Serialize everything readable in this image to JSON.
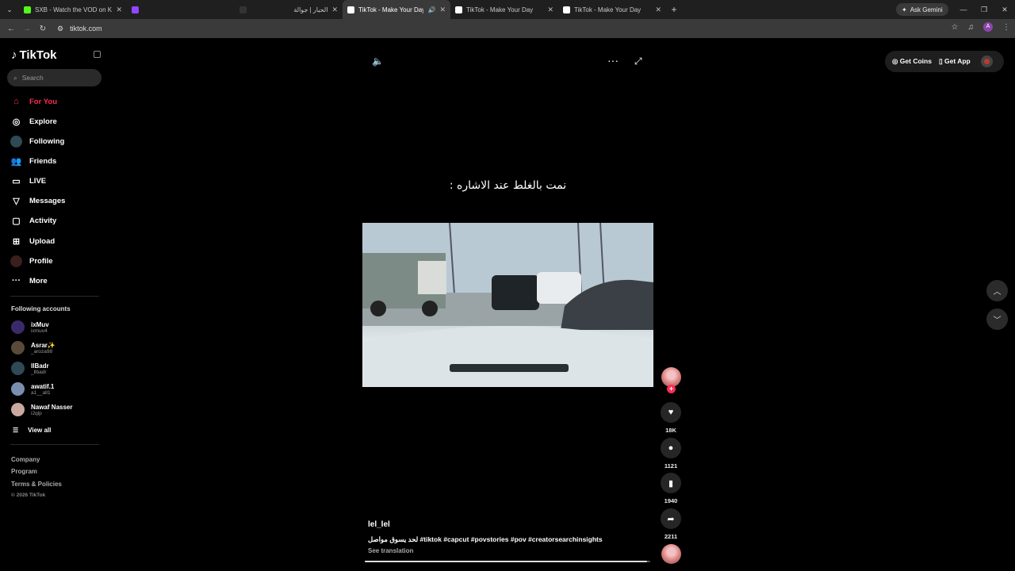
{
  "browser": {
    "tabs": [
      {
        "title": "SXB - Watch the VOD on Kick",
        "color": "#53fc18",
        "active": false,
        "audio": false
      },
      {
        "title": "",
        "color": "#9147ff",
        "active": false,
        "audio": false
      },
      {
        "title": "الحبار | جوالة",
        "color": "#333333",
        "active": false,
        "audio": false
      },
      {
        "title": "TikTok - Make Your Day",
        "color": "#ffffff",
        "active": true,
        "audio": true
      },
      {
        "title": "TikTok - Make Your Day",
        "color": "#ffffff",
        "active": false,
        "audio": false
      },
      {
        "title": "TikTok - Make Your Day",
        "color": "#ffffff",
        "active": false,
        "audio": false
      }
    ],
    "ask_gemini": "Ask Gemini",
    "url": "tiktok.com",
    "profile_initial": "A"
  },
  "sidebar": {
    "logo": "TikTok",
    "search_placeholder": "Search",
    "nav": [
      {
        "label": "For You",
        "icon": "home-icon",
        "glyph": "⌂",
        "active": true
      },
      {
        "label": "Explore",
        "icon": "compass-icon",
        "glyph": "◎",
        "active": false
      },
      {
        "label": "Following",
        "icon": "following-avatar-icon",
        "glyph": "◍",
        "active": false
      },
      {
        "label": "Friends",
        "icon": "friends-icon",
        "glyph": "👥",
        "active": false
      },
      {
        "label": "LIVE",
        "icon": "live-tv-icon",
        "glyph": "▭",
        "active": false
      },
      {
        "label": "Messages",
        "icon": "messages-icon",
        "glyph": "▽",
        "active": false
      },
      {
        "label": "Activity",
        "icon": "activity-icon",
        "glyph": "▢",
        "active": false
      },
      {
        "label": "Upload",
        "icon": "upload-icon",
        "glyph": "⊞",
        "active": false
      },
      {
        "label": "Profile",
        "icon": "profile-avatar-icon",
        "glyph": "●",
        "active": false
      },
      {
        "label": "More",
        "icon": "more-dots-icon",
        "glyph": "···",
        "active": false
      }
    ],
    "following_title": "Following accounts",
    "accounts": [
      {
        "name": "ixMuv",
        "handle": "ixmuv4",
        "color": "#3b2a6b"
      },
      {
        "name": "Asrar✨",
        "handle": "_aroza98",
        "color": "#5a4a3a"
      },
      {
        "name": "lIBadr",
        "handle": "_llbadr",
        "color": "#2f4a55"
      },
      {
        "name": "awatif.1",
        "handle": "a1__all1",
        "color": "#7a8fb0"
      },
      {
        "name": "Nawaf Nasser",
        "handle": "i2qlp",
        "color": "#c9a9a0"
      }
    ],
    "view_all": "View all",
    "footer": [
      "Company",
      "Program",
      "Terms & Policies"
    ],
    "copyright": "© 2026 TikTok"
  },
  "player": {
    "caption": "نمت بالغلط عند الاشاره :",
    "get_coins": "Get Coins",
    "get_app": "Get App",
    "progress": 0.99
  },
  "actions": {
    "likes": "18K",
    "comments": "1121",
    "saves": "1940",
    "shares": "2211"
  },
  "post": {
    "username": "lel_lel",
    "description": "لحد يسوق مواصل #tiktok #capcut #povstories #pov #creatorsearchinsights",
    "see_translation": "See translation"
  }
}
